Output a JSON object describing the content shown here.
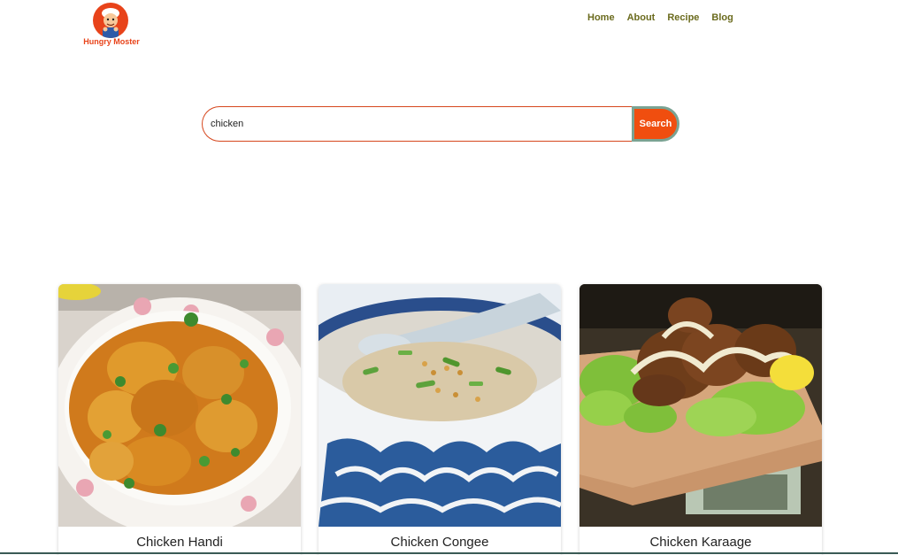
{
  "brand": {
    "name": "Hungry Moster"
  },
  "nav": {
    "items": [
      {
        "label": "Home"
      },
      {
        "label": "About"
      },
      {
        "label": "Recipe"
      },
      {
        "label": "Blog"
      }
    ]
  },
  "search": {
    "value": "chicken",
    "button_label": "Search"
  },
  "recipes": [
    {
      "title": "Chicken Handi"
    },
    {
      "title": "Chicken Congee"
    },
    {
      "title": "Chicken Karaage"
    }
  ],
  "colors": {
    "accent": "#f04e0f",
    "nav_text": "#6b6b1e",
    "search_border": "#d6471e"
  }
}
